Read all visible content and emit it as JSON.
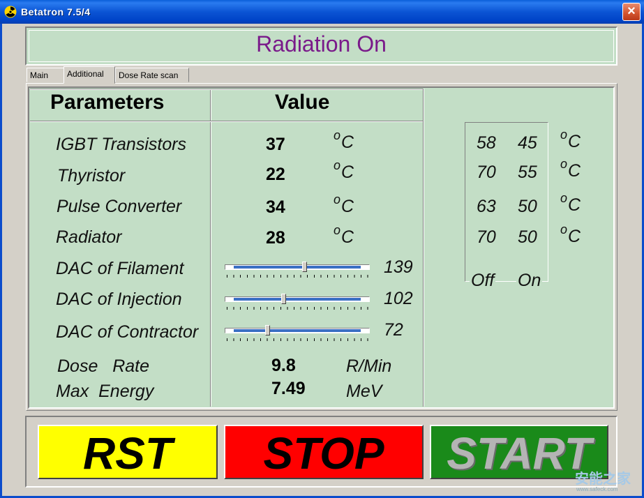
{
  "window": {
    "title": "Betatron  7.5/4",
    "close_label": "×"
  },
  "status": {
    "text": "Radiation On"
  },
  "tabs": [
    {
      "label": "Main"
    },
    {
      "label": "Additional",
      "selected": true
    },
    {
      "label": "Dose Rate scan"
    }
  ],
  "table": {
    "header_parameters": "Parameters",
    "header_value": "Value",
    "temps": [
      {
        "label": "IGBT Transistors",
        "value": "37",
        "unit_sup": "o",
        "unit": "C",
        "off": "58",
        "on": "45"
      },
      {
        "label": "Thyristor",
        "value": "22",
        "unit_sup": "o",
        "unit": "C",
        "off": "70",
        "on": "55"
      },
      {
        "label": "Pulse Converter",
        "value": "34",
        "unit_sup": "o",
        "unit": "C",
        "off": "63",
        "on": "50"
      },
      {
        "label": "Radiator",
        "value": "28",
        "unit_sup": "o",
        "unit": "C",
        "off": "70",
        "on": "50"
      }
    ],
    "dacs": [
      {
        "label": "DAC of Filament",
        "value": "139",
        "level": 0.55
      },
      {
        "label": "DAC of Injection",
        "value": "102",
        "level": 0.4
      },
      {
        "label": "DAC of Contractor",
        "value": "72",
        "level": 0.28
      }
    ],
    "dose_rate": {
      "label": "Dose   Rate",
      "value": "9.8",
      "unit": "R/Min"
    },
    "max_energy": {
      "label": "Max  Energy",
      "value": "7.49",
      "unit": "MeV"
    },
    "threshold_off_label": "Off",
    "threshold_on_label": "On"
  },
  "buttons": {
    "rst": "RST",
    "stop": "STOP",
    "start": "START"
  },
  "watermark": {
    "text": "安能之家",
    "sub": "www.safeck.com"
  },
  "colors": {
    "panel_green": "#c3dec6",
    "status_text": "#7a1a8a",
    "rst": "#ffff00",
    "stop": "#ff0000",
    "start": "#1a8a1a"
  }
}
